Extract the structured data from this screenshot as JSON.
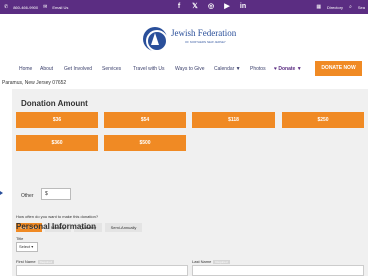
{
  "topbar": {
    "phone": "860-466-9900",
    "email_label": "Email Us",
    "social_icons": [
      "facebook-icon",
      "twitter-icon",
      "instagram-icon",
      "youtube-icon",
      "linkedin-icon"
    ],
    "social_glyphs": [
      "f",
      "𝕏",
      "◎",
      "▶",
      "in"
    ],
    "directory": "Directory",
    "search": "Sea"
  },
  "logo": {
    "name": "Jewish Federation",
    "sub": "OF NORTHERN NEW JERSEY"
  },
  "nav": {
    "items": [
      "Home",
      "About",
      "Get Involved",
      "Services",
      "Travel with Us",
      "Ways to Give",
      "Calendar ▼",
      "Photos"
    ],
    "donate_dropdown": "Donate ▼",
    "donate_now": "DONATE NOW"
  },
  "location": "Paramus, New Jersey 07652",
  "donation": {
    "heading": "Donation Amount",
    "amounts": [
      "$36",
      "$54",
      "$118",
      "$250",
      "$360",
      "$500"
    ],
    "other_label": "Other",
    "other_value": "$"
  },
  "frequency": {
    "question": "How often do you want to make this donation?",
    "options": [
      "One Time",
      "Monthly",
      "Quarterly",
      "Semi-Annually"
    ],
    "selected": "One Time"
  },
  "personal": {
    "heading": "Personal Information",
    "title_label": "Title",
    "title_select": "Select ▾",
    "first_name": "First Name",
    "last_name": "Last Name",
    "required": "Required"
  },
  "colors": {
    "brand_purple": "#5b2d82",
    "accent_orange": "#f08a24",
    "logo_blue": "#2a4f9a"
  }
}
